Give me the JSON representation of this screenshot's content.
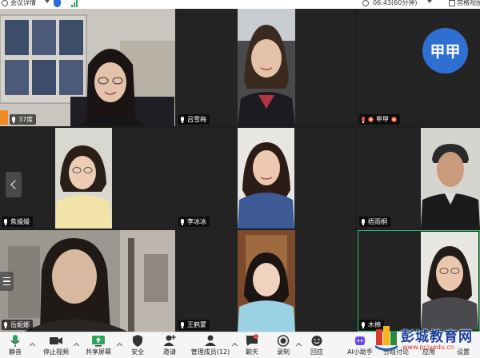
{
  "topbar": {
    "meeting_info": "会议详情",
    "time": "06:43(60分钟)",
    "view": "宫格视图"
  },
  "participants": [
    {
      "name": "37度",
      "muted": false,
      "video": true
    },
    {
      "name": "吕雪梅",
      "muted": false,
      "video": true
    },
    {
      "name": "甲甲",
      "muted": true,
      "video": false,
      "avatar_text": "甲甲",
      "avatar_color": "#2f6fd1"
    },
    {
      "name": "焦嫚嫚",
      "muted": false,
      "video": true
    },
    {
      "name": "李冰冰",
      "muted": false,
      "video": true
    },
    {
      "name": "梧雨桐",
      "muted": false,
      "video": true
    },
    {
      "name": "岳妮娜",
      "muted": false,
      "video": true
    },
    {
      "name": "王鹤蒙",
      "muted": false,
      "video": true
    },
    {
      "name": "木棉",
      "muted": false,
      "video": true,
      "active_speaker": true
    }
  ],
  "toolbar": {
    "mute": "静音",
    "stop_video": "停止视频",
    "share_screen": "共享屏幕",
    "security": "安全",
    "invite": "邀请",
    "manage": "管理成员(12)",
    "chat": "聊天",
    "record": "录制",
    "reactions": "回应",
    "ai": "AI小助手",
    "breakout": "分组讨论",
    "apps": "应用",
    "settings": "设置"
  },
  "watermark": {
    "title": "彭城教育网",
    "url": "www.pcjyedu.cn"
  },
  "colors": {
    "active_border": "#27c267",
    "avatar_bg": "#2f6fd1",
    "toolbar_bg": "#f5f5f5"
  }
}
